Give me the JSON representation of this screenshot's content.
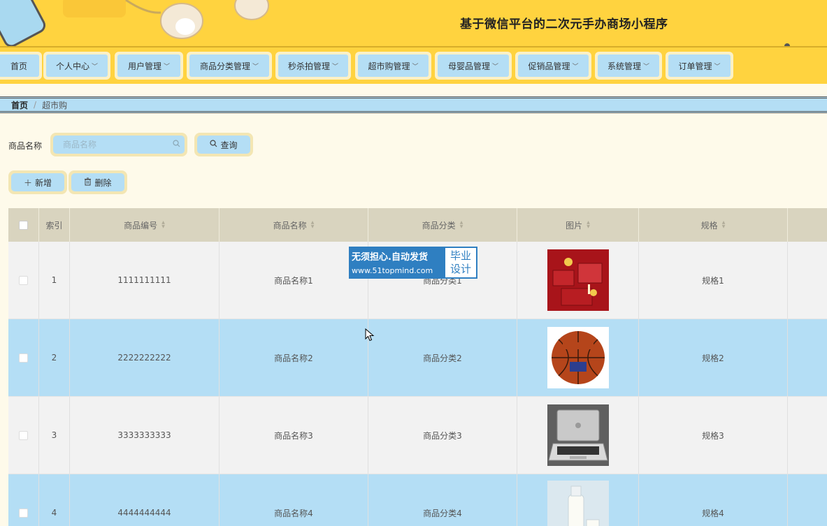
{
  "header": {
    "title": "基于微信平台的二次元手办商场小程序"
  },
  "nav": {
    "items": [
      {
        "label": "首页",
        "has_dropdown": false
      },
      {
        "label": "个人中心",
        "has_dropdown": true
      },
      {
        "label": "用户管理",
        "has_dropdown": true
      },
      {
        "label": "商品分类管理",
        "has_dropdown": true
      },
      {
        "label": "秒杀拍管理",
        "has_dropdown": true
      },
      {
        "label": "超市购管理",
        "has_dropdown": true
      },
      {
        "label": "母婴品管理",
        "has_dropdown": true
      },
      {
        "label": "促销品管理",
        "has_dropdown": true
      },
      {
        "label": "系统管理",
        "has_dropdown": true
      },
      {
        "label": "订单管理",
        "has_dropdown": true
      }
    ]
  },
  "breadcrumb": {
    "home": "首页",
    "separator": "/",
    "current": "超市购"
  },
  "search": {
    "label": "商品名称",
    "placeholder": "商品名称",
    "query_button": "查询"
  },
  "actions": {
    "add_button": "新增",
    "delete_button": "删除"
  },
  "table": {
    "columns": [
      "索引",
      "商品编号",
      "商品名称",
      "商品分类",
      "图片",
      "规格"
    ],
    "rows": [
      {
        "index": "1",
        "code": "1111111111",
        "name": "商品名称1",
        "category": "商品分类1",
        "image": "red-gift-box-photo",
        "spec": "规格1"
      },
      {
        "index": "2",
        "code": "2222222222",
        "name": "商品名称2",
        "category": "商品分类2",
        "image": "basketball-photo",
        "spec": "规格2"
      },
      {
        "index": "3",
        "code": "3333333333",
        "name": "商品名称3",
        "category": "商品分类3",
        "image": "laptop-photo",
        "spec": "规格3"
      },
      {
        "index": "4",
        "code": "4444444444",
        "name": "商品名称4",
        "category": "商品分类4",
        "image": "milk-bottle-photo",
        "spec": "规格4"
      }
    ]
  },
  "watermark": {
    "line1": "无须担心.自动发货",
    "line2": "www.51topmind.com",
    "badge1": "毕业",
    "badge2": "设计"
  },
  "colors": {
    "header_bg": "#ffd33f",
    "accent_blue": "#b4def5",
    "page_bg": "#fefaea",
    "table_header_bg": "#d9d4bf"
  }
}
